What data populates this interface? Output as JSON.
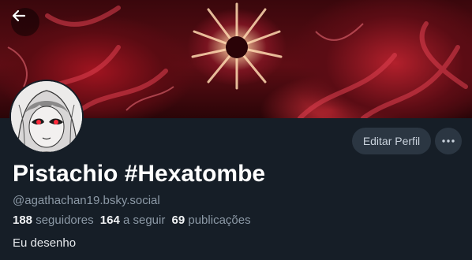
{
  "profile": {
    "display_name": "Pistachio #Hexatombe",
    "handle": "@agathachan19.bsky.social",
    "bio": "Eu desenho"
  },
  "stats": {
    "followers_count": "188",
    "followers_label": "seguidores",
    "following_count": "164",
    "following_label": "a seguir",
    "posts_count": "69",
    "posts_label": "publicações"
  },
  "actions": {
    "edit_label": "Editar Perfil"
  },
  "icons": {
    "back": "arrow-left-icon",
    "more": "ellipsis-icon"
  },
  "colors": {
    "background": "#161e27",
    "button_bg": "#2b3642",
    "muted_text": "#8c99a6"
  }
}
